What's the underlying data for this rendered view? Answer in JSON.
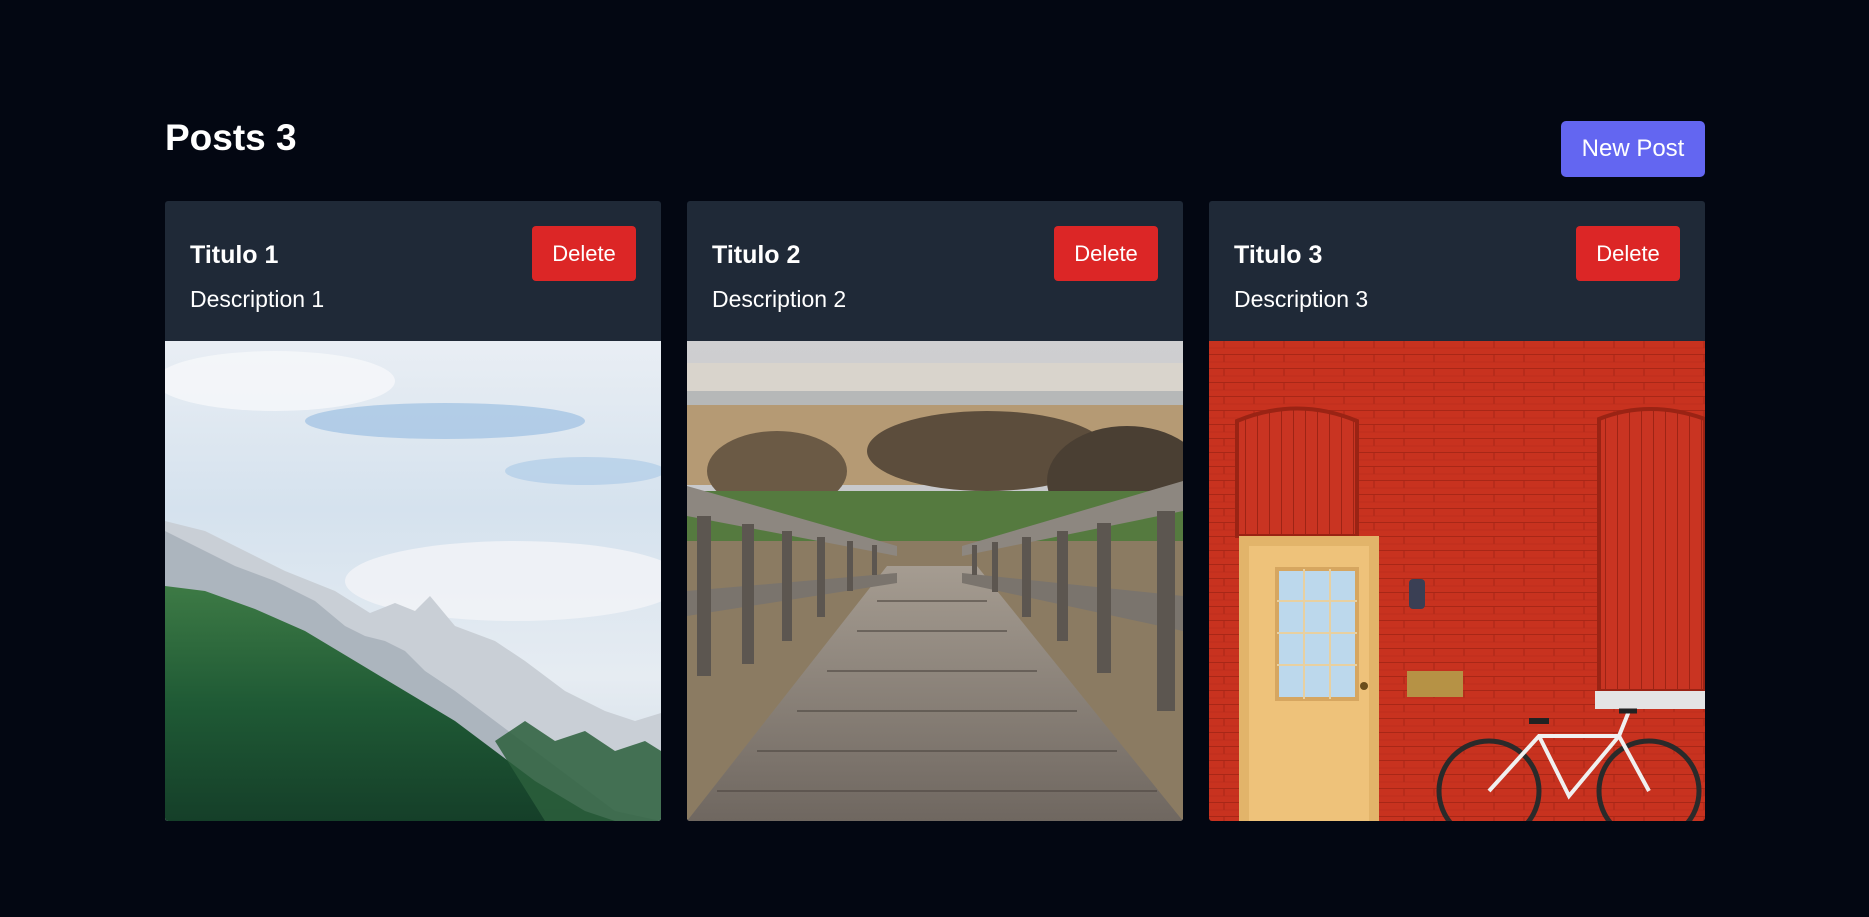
{
  "header": {
    "title": "Posts 3",
    "new_post_label": "New Post"
  },
  "posts": [
    {
      "title": "Titulo 1",
      "description": "Description 1",
      "delete_label": "Delete",
      "image": "mountain-forest-photo"
    },
    {
      "title": "Titulo 2",
      "description": "Description 2",
      "delete_label": "Delete",
      "image": "wooden-boardwalk-photo"
    },
    {
      "title": "Titulo 3",
      "description": "Description 3",
      "delete_label": "Delete",
      "image": "red-brick-wall-door-bicycle-photo"
    }
  ],
  "colors": {
    "background": "#030712",
    "card": "#1f2937",
    "accent": "#6366f1",
    "danger": "#dc2626"
  }
}
